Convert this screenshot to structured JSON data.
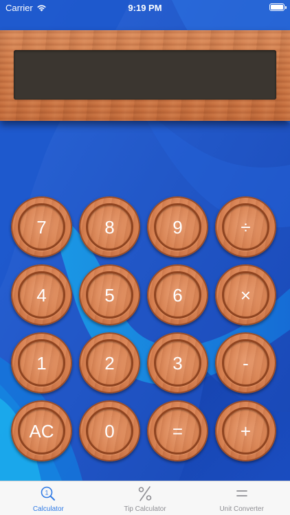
{
  "status_bar": {
    "carrier": "Carrier",
    "time": "9:19 PM",
    "wifi_icon": "wifi-icon",
    "battery_icon": "battery-icon"
  },
  "display": {
    "value": ""
  },
  "keypad": {
    "rows": [
      [
        "7",
        "8",
        "9",
        "÷"
      ],
      [
        "4",
        "5",
        "6",
        "×"
      ],
      [
        "1",
        "2",
        "3",
        "-"
      ],
      [
        "AC",
        "0",
        "=",
        "+"
      ]
    ]
  },
  "tab_bar": {
    "tabs": [
      {
        "label": "Calculator",
        "icon": "magnifier-one-icon",
        "active": true
      },
      {
        "label": "Tip Calculator",
        "icon": "percent-icon",
        "active": false
      },
      {
        "label": "Unit Converter",
        "icon": "equals-icon",
        "active": false
      }
    ]
  },
  "colors": {
    "background_blue": "#1d4fc0",
    "wood": "#d67f4f",
    "display_bg": "#3b3630",
    "tab_active": "#2f7ae5",
    "tab_inactive": "#8e8e93"
  }
}
